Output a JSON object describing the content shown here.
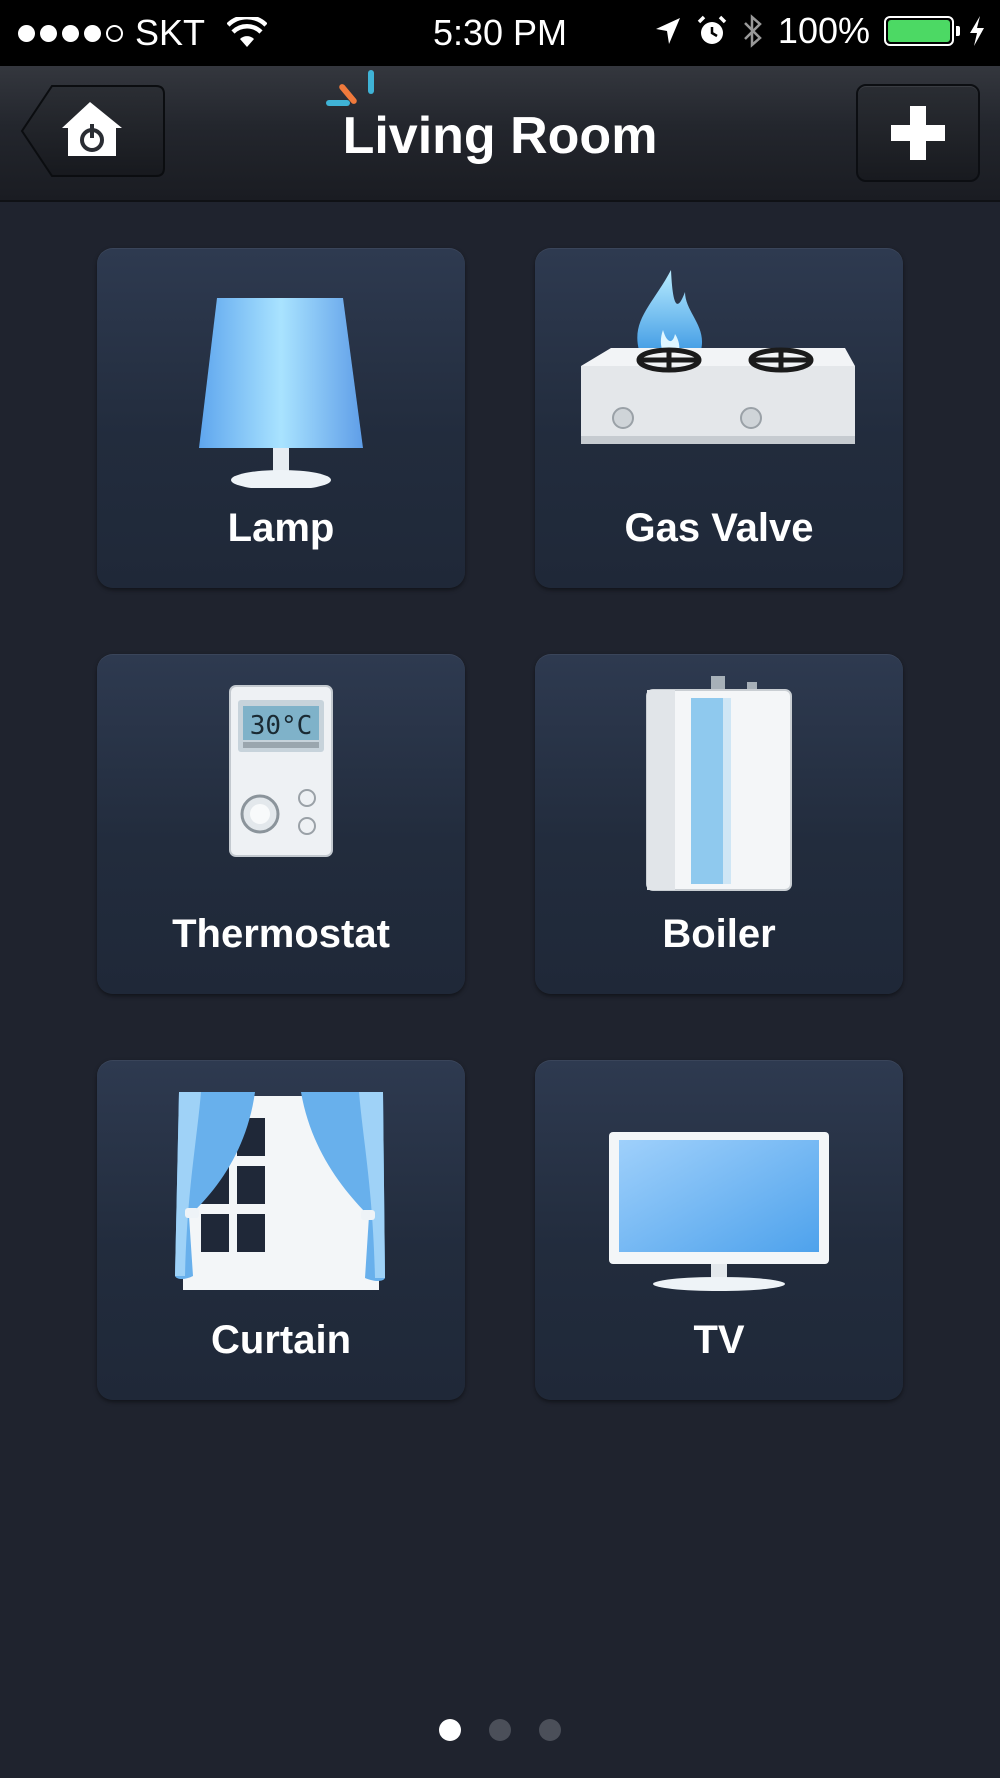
{
  "status_bar": {
    "carrier": "SKT",
    "time": "5:30 PM",
    "battery": "100%",
    "signal_bars_filled": 4,
    "signal_bars_total": 5
  },
  "header": {
    "title": "Living Room",
    "home_icon": "home-power-icon",
    "add_icon": "plus-icon"
  },
  "devices": [
    {
      "label": "Lamp",
      "icon": "lamp-icon"
    },
    {
      "label": "Gas Valve",
      "icon": "gas-stove-icon"
    },
    {
      "label": "Thermostat",
      "icon": "thermostat-icon",
      "display": "30°C"
    },
    {
      "label": "Boiler",
      "icon": "boiler-icon"
    },
    {
      "label": "Curtain",
      "icon": "curtain-icon"
    },
    {
      "label": "TV",
      "icon": "tv-icon"
    }
  ],
  "pagination": {
    "current": 1,
    "total": 3
  },
  "colors": {
    "background": "#1f232e",
    "tile": "#26314a",
    "accent_blue": "#7cc4f5",
    "battery_green": "#4cd964"
  }
}
